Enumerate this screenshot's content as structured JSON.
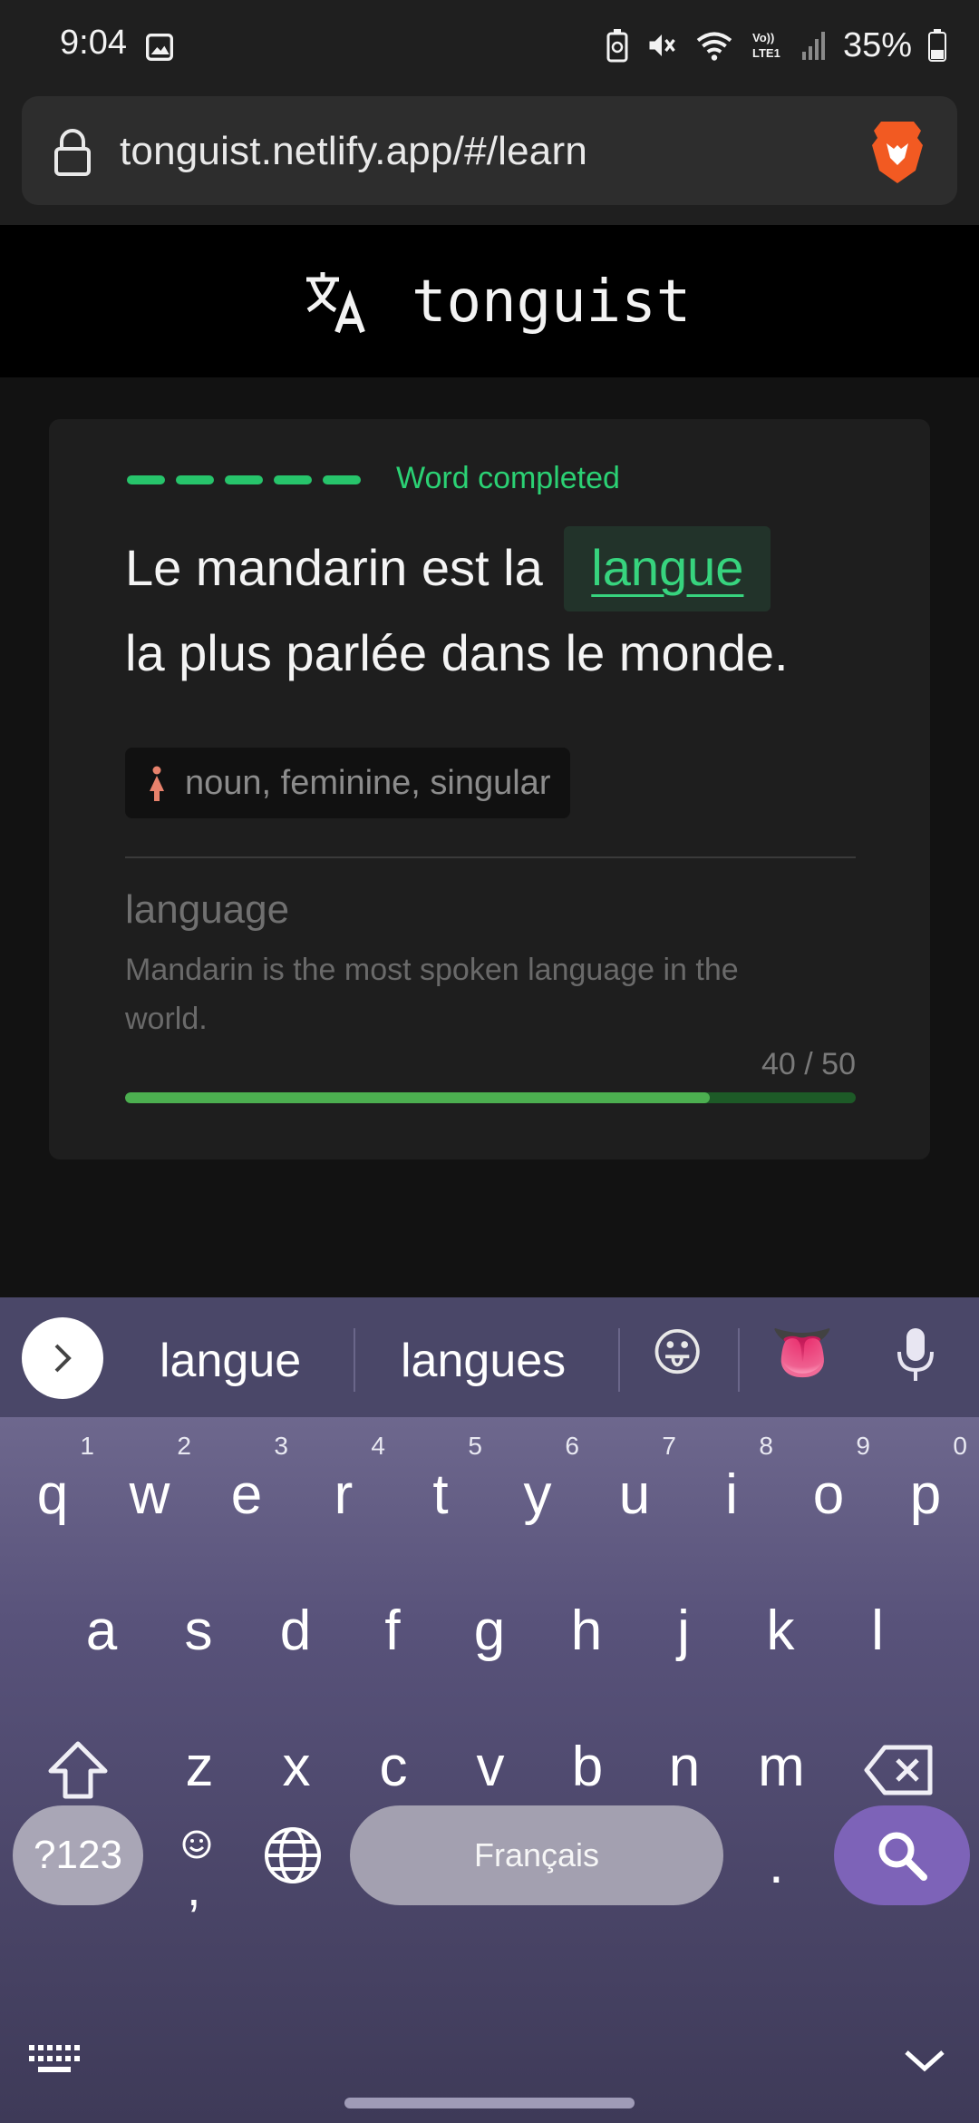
{
  "status_bar": {
    "time": "9:04",
    "battery": "35%",
    "icons": [
      "gallery-icon",
      "battery-saver-icon",
      "mute-icon",
      "wifi-icon",
      "volte-icon",
      "signal-icon",
      "battery-icon"
    ]
  },
  "browser": {
    "url": "tonguist.netlify.app/#/learn"
  },
  "app": {
    "title": "tonguist"
  },
  "card": {
    "status": "Word completed",
    "sentence_before": "Le mandarin est la",
    "answer": "langue",
    "sentence_after": "la plus parlée dans le monde.",
    "grammar": "noun, feminine, singular",
    "translation": "language",
    "example": "Mandarin is the most spoken language in the world.",
    "progress_label": "40 / 50",
    "progress_fraction": 0.8,
    "dash_count": 5
  },
  "keyboard": {
    "suggestions": [
      "langue",
      "langues"
    ],
    "emoji": [
      "😛",
      "👅"
    ],
    "row1": [
      {
        "k": "q",
        "n": "1"
      },
      {
        "k": "w",
        "n": "2"
      },
      {
        "k": "e",
        "n": "3"
      },
      {
        "k": "r",
        "n": "4"
      },
      {
        "k": "t",
        "n": "5"
      },
      {
        "k": "y",
        "n": "6"
      },
      {
        "k": "u",
        "n": "7"
      },
      {
        "k": "i",
        "n": "8"
      },
      {
        "k": "o",
        "n": "9"
      },
      {
        "k": "p",
        "n": "0"
      }
    ],
    "row2": [
      "a",
      "s",
      "d",
      "f",
      "g",
      "h",
      "j",
      "k",
      "l"
    ],
    "row3": [
      "z",
      "x",
      "c",
      "v",
      "b",
      "n",
      "m"
    ],
    "symbols_label": "?123",
    "comma": ",",
    "period": ".",
    "space_label": "Français"
  },
  "colors": {
    "accent_green": "#27c46b",
    "keyboard_purple": "#7d63b8"
  }
}
